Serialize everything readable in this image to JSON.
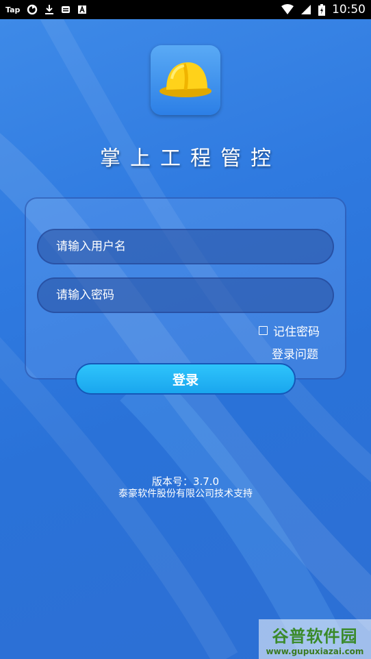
{
  "status_bar": {
    "app_label": "Tap",
    "time": "10:50",
    "icons": [
      "tap-app-icon",
      "sync-icon",
      "download-icon",
      "message-icon",
      "text-icon",
      "wifi-icon",
      "signal-icon",
      "battery-icon"
    ]
  },
  "app": {
    "icon": "hard-hat-icon",
    "title": "掌上工程管控"
  },
  "login": {
    "username_placeholder": "请输入用户名",
    "password_placeholder": "请输入密码",
    "remember_label": "记住密码",
    "remember_checked": false,
    "problem_link": "登录问题",
    "submit_label": "登录"
  },
  "footer": {
    "version": "版本号：3.7.0",
    "support": "泰豪软件股份有限公司技术支持"
  },
  "watermark": {
    "brand": "谷普软件园",
    "url": "www.gupuxiazai.com"
  },
  "colors": {
    "background": "#2f7ae0",
    "button": "#1fb3f4",
    "field": "#2e5aa8"
  }
}
